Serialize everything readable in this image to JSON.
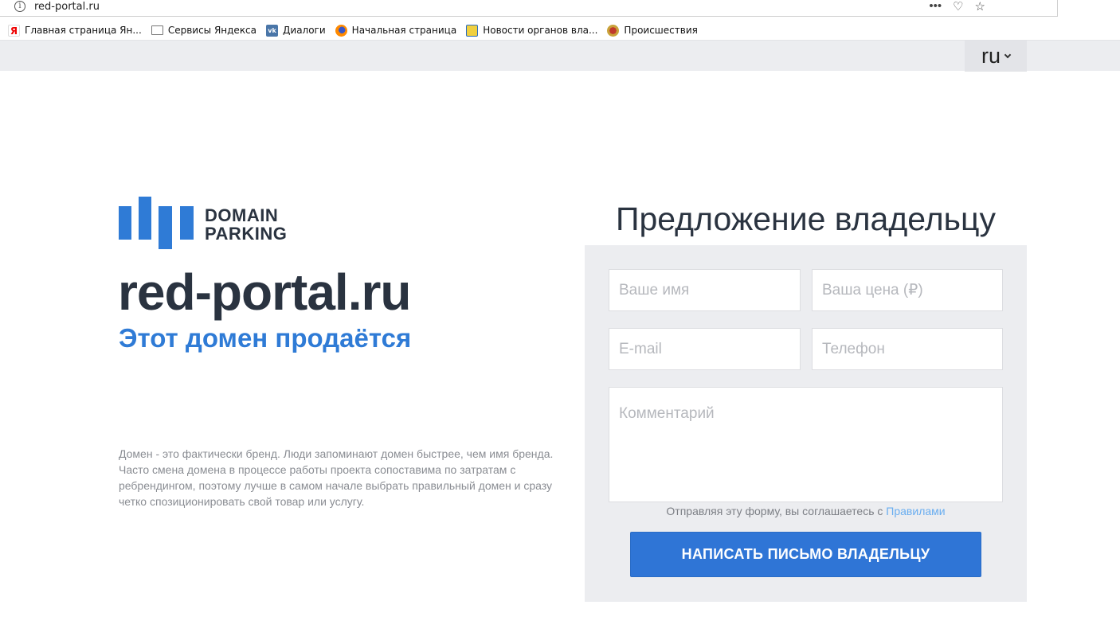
{
  "browser": {
    "url": "red-portal.ru",
    "info_glyph": "i",
    "actions": [
      "•••",
      "♡",
      "☆"
    ]
  },
  "bookmarks": [
    {
      "label": "Главная страница Ян...",
      "icon": "yandex-icon",
      "glyph": "Я"
    },
    {
      "label": "Сервисы Яндекса",
      "icon": "folder-icon",
      "glyph": ""
    },
    {
      "label": "Диалоги",
      "icon": "vk-icon",
      "glyph": "vk"
    },
    {
      "label": "Начальная страница",
      "icon": "firefox-icon",
      "glyph": ""
    },
    {
      "label": "Новости органов вла...",
      "icon": "news-icon",
      "glyph": ""
    },
    {
      "label": "Происшествия",
      "icon": "incident-icon",
      "glyph": ""
    }
  ],
  "topbar": {
    "language": "ru"
  },
  "logo": {
    "line1": "DOMAIN",
    "line2": "PARKING",
    "color": "#2f7bd6"
  },
  "hero": {
    "domain": "red-portal.ru",
    "tagline": "Этот домен продаётся",
    "description": "Домен - это фактически бренд. Люди запоминают домен быстрее, чем имя бренда. Часто смена домена в процессе работы проекта сопоставима по затратам с ребрендингом, поэтому лучше в самом начале выбрать правильный домен и сразу четко спозиционировать свой товар или услугу."
  },
  "form": {
    "title": "Предложение владельцу",
    "name_placeholder": "Ваше имя",
    "price_placeholder": "Ваша цена (₽)",
    "email_placeholder": "E-mail",
    "phone_placeholder": "Телефон",
    "comment_placeholder": "Комментарий",
    "terms_text": "Отправляя эту форму, вы соглашаетесь с ",
    "terms_link": "Правилами",
    "submit_label": "НАПИСАТЬ ПИСЬМО ВЛАДЕЛЬЦУ"
  },
  "colors": {
    "accent": "#2f7bd6",
    "dark_text": "#2a3340",
    "panel_bg": "#ecedf0"
  }
}
